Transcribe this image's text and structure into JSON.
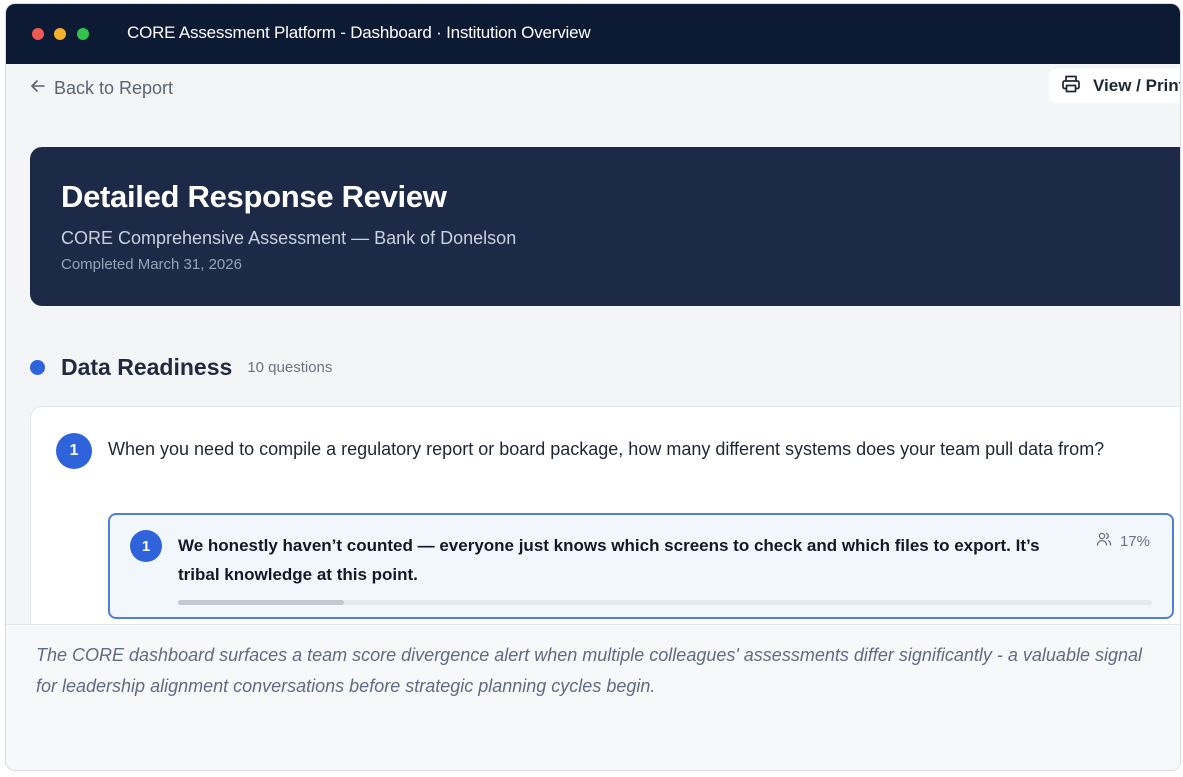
{
  "window": {
    "title": "CORE Assessment Platform - Dashboard · Institution Overview"
  },
  "toolbar": {
    "back_label": "Back to Report",
    "print_label": "View / Print"
  },
  "hero": {
    "title": "Detailed Response Review",
    "subtitle": "CORE Comprehensive Assessment — Bank of Donelson",
    "completed": "Completed March 31, 2026"
  },
  "section": {
    "title": "Data Readiness",
    "count": "10 questions"
  },
  "question": {
    "number": "1",
    "text": "When you need to compile a regulatory report or board package, how many different systems does your team pull data from?"
  },
  "answer": {
    "number": "1",
    "text": "We honestly haven’t counted — everyone just knows which screens to check and which files to export. It’s tribal knowledge at this point.",
    "percent_label": "17%",
    "percent_value": 0.17,
    "icon": "users-icon"
  },
  "caption": "The CORE dashboard surfaces a team score divergence alert when multiple colleagues' assessments differ significantly - a valuable signal for leadership alignment conversations before strategic planning cycles begin.",
  "colors": {
    "titlebar": "#0c1a33",
    "hero": "#1c2947",
    "accent": "#2f63dc",
    "selected_border": "#4f7fd9"
  }
}
